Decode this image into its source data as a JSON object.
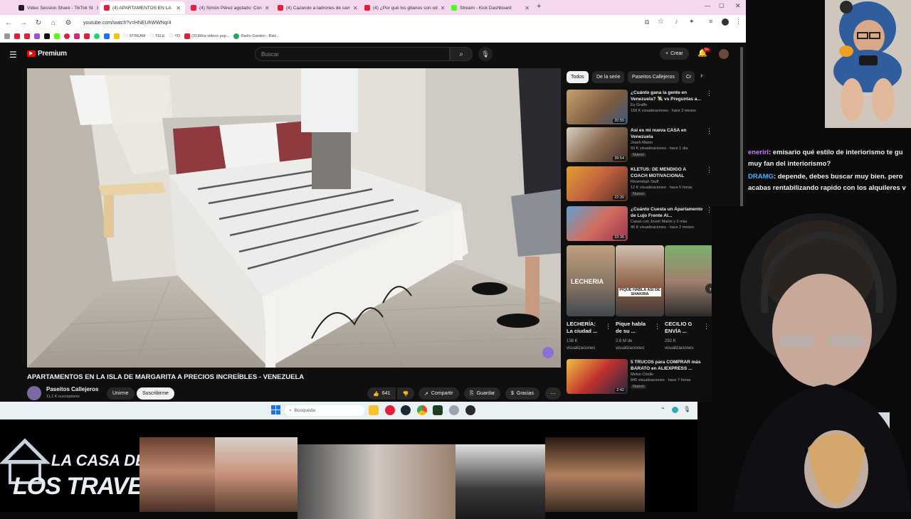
{
  "browser": {
    "tabs": [
      {
        "label": "Video Session Share - TikTok St",
        "fav": "#1f1f1f"
      },
      {
        "label": "(4) APARTAMENTOS EN LA",
        "fav": "#e41e3a"
      },
      {
        "label": "(4) Simón Pérez agotado: Con",
        "fav": "#e41e3a"
      },
      {
        "label": "(4) Cazando a ladrones de carr",
        "fav": "#e41e3a"
      },
      {
        "label": "(4) ¿Por qué los gitanos son od",
        "fav": "#e41e3a"
      },
      {
        "label": "Stream - Kick Dashboard",
        "fav": "#53fc18"
      }
    ],
    "url": "youtube.com/watch?v=HNEUhWWNq/4",
    "bookmarks": [
      {
        "label": "STREAM",
        "color": "#8a8a8a"
      },
      {
        "label": "TELE",
        "color": "#8a8a8a"
      },
      {
        "label": "YO",
        "color": "#8a8a8a"
      },
      {
        "label": "(31)Mira videos pup...",
        "color": "#e41e3a"
      },
      {
        "label": "Radio Garden - Balz...",
        "color": "#2aa36b"
      }
    ]
  },
  "youtube": {
    "logo": "Premium",
    "search_placeholder": "Buscar",
    "create_label": "Crear",
    "notif_count": "9+",
    "video_title": "APARTAMENTOS EN LA ISLA DE MARGARITA A PRECIOS INCREÍBLES - VENEZUELA",
    "channel_name": "Paseitos Callejeros",
    "subscribers": "11,1 K suscriptores",
    "join_label": "Unirme",
    "subscribe_label": "Suscribirme",
    "likes": "641",
    "share_label": "Compartir",
    "save_label": "Guardar",
    "thanks_label": "Gracias",
    "chips": [
      "Todos",
      "De la serie",
      "Paseitos Callejeros",
      "Cr"
    ],
    "recommendations": [
      {
        "title": "¿Cuánto gana la gente en Venezuela? 💸 vs Preguntas a...",
        "channel": "Ey Graffe",
        "meta": "158 K visualizaciones · hace 2 meses",
        "duration": "20:55",
        "nuevo": ""
      },
      {
        "title": "Así es mi nueva CASA en Venezuela",
        "channel": "Joseh Malon",
        "meta": "69 K visualizaciones · hace 1 día",
        "duration": "39:54",
        "nuevo": "Nuevo"
      },
      {
        "title": "KLETUS: DE MENDIGO A COACH MOTIVACIONAL",
        "channel": "Rimembah Stuff",
        "meta": "12 K visualizaciones · hace 5 horas",
        "duration": "22:30",
        "nuevo": "Nuevo"
      },
      {
        "title": "¿Cuánto Cuesta un Apartamento de Lujo Frente Al...",
        "channel": "Casas con Joseh Malon y 2 más",
        "meta": "46 K visualizaciones · hace 2 meses",
        "duration": "33:35",
        "nuevo": ""
      },
      {
        "title": "5 TRUCOS para COMPRAR más BARATO en ALIEXPRESS ...",
        "channel": "Melon Chollo",
        "meta": "845 visualizaciones · hace 7 horas",
        "duration": "2:42",
        "nuevo": "Nuevo"
      }
    ],
    "shorts": [
      {
        "title": "LECHERÍA: La ciudad ...",
        "views": "138 K",
        "suffix": "visualizaciones",
        "overlay": "LECHERIA"
      },
      {
        "title": "Pique habla de su ...",
        "views": "2,6 M de",
        "suffix": "visualizaciones",
        "overlay": "PIQUE HABLA ASÍ DE SHAKIRA"
      },
      {
        "title": "CECILIO G ENVÍA ...",
        "views": "292 K",
        "suffix": "visualizaciones",
        "overlay": ""
      }
    ]
  },
  "taskbar": {
    "search_label": "Búsqueda"
  },
  "chat": [
    {
      "user": "enerirl",
      "user_color": "#c77dff",
      "line1": ": emisario qué estilo de interiorismo te gu",
      "line2": "muy fan del interiorismo?"
    },
    {
      "user": "DRAMG",
      "user_color": "#3cb4ff",
      "line1": ": depende, debes buscar muy bien. pero",
      "line2": "acabas rentabilizando rapido con los alquileres v"
    }
  ],
  "overlay": {
    "banner_line1": "LA CASA DE",
    "banner_line2": "LOS TRAVELOS"
  }
}
